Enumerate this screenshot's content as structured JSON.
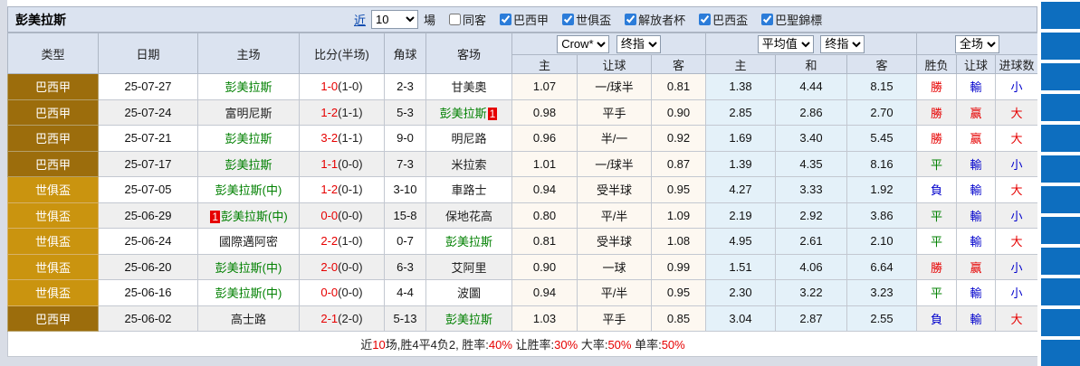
{
  "titlebar": {
    "team": "彭美拉斯",
    "near_link": "近",
    "games_value": "10",
    "games_suffix": "場",
    "checkboxes": [
      {
        "label": "同客",
        "checked": false
      },
      {
        "label": "巴西甲",
        "checked": true
      },
      {
        "label": "世俱盃",
        "checked": true
      },
      {
        "label": "解放者杯",
        "checked": true
      },
      {
        "label": "巴西盃",
        "checked": true
      },
      {
        "label": "巴聖錦標",
        "checked": true
      }
    ]
  },
  "header": {
    "type": "类型",
    "date": "日期",
    "home": "主场",
    "score": "比分(半场)",
    "corner": "角球",
    "away": "客场",
    "odds_source_select": "Crow*",
    "odds_kind_select": "终指",
    "avg_source_select": "平均值",
    "avg_kind_select": "终指",
    "scope_select": "全场",
    "sub": {
      "odds_home": "主",
      "odds_handicap": "让球",
      "odds_away": "客",
      "avg_home": "主",
      "avg_draw": "和",
      "avg_away": "客",
      "result": "胜负",
      "handicap_result": "让球",
      "goals": "进球数"
    }
  },
  "rows": [
    {
      "league": "巴西甲",
      "league_c": "dark",
      "date": "25-07-27",
      "home_badge_b": "",
      "home_name": "彭美拉斯",
      "home_c": "g",
      "home_badge_a": "",
      "score_ft": "1-0",
      "score_ht": "(1-0)",
      "corner": "2-3",
      "away_badge_b": "",
      "away_name": "甘美奧",
      "away_c": "k",
      "away_badge_a": "",
      "odds_home": "1.07",
      "odds_handicap": "一/球半",
      "odds_away": "0.81",
      "avg_home": "1.38",
      "avg_draw": "4.44",
      "avg_away": "8.15",
      "result": "勝",
      "result_c": "r",
      "handicap_result": "輸",
      "handicap_c": "b",
      "goals": "小",
      "goals_c": "b"
    },
    {
      "league": "巴西甲",
      "league_c": "dark",
      "date": "25-07-24",
      "home_badge_b": "",
      "home_name": "富明尼斯",
      "home_c": "k",
      "home_badge_a": "",
      "score_ft": "1-2",
      "score_ht": "(1-1)",
      "corner": "5-3",
      "away_badge_b": "",
      "away_name": "彭美拉斯",
      "away_c": "g",
      "away_badge_a": "1",
      "odds_home": "0.98",
      "odds_handicap": "平手",
      "odds_away": "0.90",
      "avg_home": "2.85",
      "avg_draw": "2.86",
      "avg_away": "2.70",
      "result": "勝",
      "result_c": "r",
      "handicap_result": "赢",
      "handicap_c": "r",
      "goals": "大",
      "goals_c": "r"
    },
    {
      "league": "巴西甲",
      "league_c": "dark",
      "date": "25-07-21",
      "home_badge_b": "",
      "home_name": "彭美拉斯",
      "home_c": "g",
      "home_badge_a": "",
      "score_ft": "3-2",
      "score_ht": "(1-1)",
      "corner": "9-0",
      "away_badge_b": "",
      "away_name": "明尼路",
      "away_c": "k",
      "away_badge_a": "",
      "odds_home": "0.96",
      "odds_handicap": "半/一",
      "odds_away": "0.92",
      "avg_home": "1.69",
      "avg_draw": "3.40",
      "avg_away": "5.45",
      "result": "勝",
      "result_c": "r",
      "handicap_result": "赢",
      "handicap_c": "r",
      "goals": "大",
      "goals_c": "r"
    },
    {
      "league": "巴西甲",
      "league_c": "dark",
      "date": "25-07-17",
      "home_badge_b": "",
      "home_name": "彭美拉斯",
      "home_c": "g",
      "home_badge_a": "",
      "score_ft": "1-1",
      "score_ht": "(0-0)",
      "corner": "7-3",
      "away_badge_b": "",
      "away_name": "米拉索",
      "away_c": "k",
      "away_badge_a": "",
      "odds_home": "1.01",
      "odds_handicap": "一/球半",
      "odds_away": "0.87",
      "avg_home": "1.39",
      "avg_draw": "4.35",
      "avg_away": "8.16",
      "result": "平",
      "result_c": "g",
      "handicap_result": "輸",
      "handicap_c": "b",
      "goals": "小",
      "goals_c": "b"
    },
    {
      "league": "世俱盃",
      "league_c": "gold",
      "date": "25-07-05",
      "home_badge_b": "",
      "home_name": "彭美拉斯(中)",
      "home_c": "g",
      "home_badge_a": "",
      "score_ft": "1-2",
      "score_ht": "(0-1)",
      "corner": "3-10",
      "away_badge_b": "",
      "away_name": "車路士",
      "away_c": "k",
      "away_badge_a": "",
      "odds_home": "0.94",
      "odds_handicap": "受半球",
      "odds_away": "0.95",
      "avg_home": "4.27",
      "avg_draw": "3.33",
      "avg_away": "1.92",
      "result": "負",
      "result_c": "b",
      "handicap_result": "輸",
      "handicap_c": "b",
      "goals": "大",
      "goals_c": "r"
    },
    {
      "league": "世俱盃",
      "league_c": "gold",
      "date": "25-06-29",
      "home_badge_b": "1",
      "home_name": "彭美拉斯(中)",
      "home_c": "g",
      "home_badge_a": "",
      "score_ft": "0-0",
      "score_ht": "(0-0)",
      "corner": "15-8",
      "away_badge_b": "",
      "away_name": "保地花高",
      "away_c": "k",
      "away_badge_a": "",
      "odds_home": "0.80",
      "odds_handicap": "平/半",
      "odds_away": "1.09",
      "avg_home": "2.19",
      "avg_draw": "2.92",
      "avg_away": "3.86",
      "result": "平",
      "result_c": "g",
      "handicap_result": "輸",
      "handicap_c": "b",
      "goals": "小",
      "goals_c": "b"
    },
    {
      "league": "世俱盃",
      "league_c": "gold",
      "date": "25-06-24",
      "home_badge_b": "",
      "home_name": "國際邁阿密",
      "home_c": "k",
      "home_badge_a": "",
      "score_ft": "2-2",
      "score_ht": "(1-0)",
      "corner": "0-7",
      "away_badge_b": "",
      "away_name": "彭美拉斯",
      "away_c": "g",
      "away_badge_a": "",
      "odds_home": "0.81",
      "odds_handicap": "受半球",
      "odds_away": "1.08",
      "avg_home": "4.95",
      "avg_draw": "2.61",
      "avg_away": "2.10",
      "result": "平",
      "result_c": "g",
      "handicap_result": "輸",
      "handicap_c": "b",
      "goals": "大",
      "goals_c": "r"
    },
    {
      "league": "世俱盃",
      "league_c": "gold",
      "date": "25-06-20",
      "home_badge_b": "",
      "home_name": "彭美拉斯(中)",
      "home_c": "g",
      "home_badge_a": "",
      "score_ft": "2-0",
      "score_ht": "(0-0)",
      "corner": "6-3",
      "away_badge_b": "",
      "away_name": "艾阿里",
      "away_c": "k",
      "away_badge_a": "",
      "odds_home": "0.90",
      "odds_handicap": "一球",
      "odds_away": "0.99",
      "avg_home": "1.51",
      "avg_draw": "4.06",
      "avg_away": "6.64",
      "result": "勝",
      "result_c": "r",
      "handicap_result": "赢",
      "handicap_c": "r",
      "goals": "小",
      "goals_c": "b"
    },
    {
      "league": "世俱盃",
      "league_c": "gold",
      "date": "25-06-16",
      "home_badge_b": "",
      "home_name": "彭美拉斯(中)",
      "home_c": "g",
      "home_badge_a": "",
      "score_ft": "0-0",
      "score_ht": "(0-0)",
      "corner": "4-4",
      "away_badge_b": "",
      "away_name": "波圖",
      "away_c": "k",
      "away_badge_a": "",
      "odds_home": "0.94",
      "odds_handicap": "平/半",
      "odds_away": "0.95",
      "avg_home": "2.30",
      "avg_draw": "3.22",
      "avg_away": "3.23",
      "result": "平",
      "result_c": "g",
      "handicap_result": "輸",
      "handicap_c": "b",
      "goals": "小",
      "goals_c": "b"
    },
    {
      "league": "巴西甲",
      "league_c": "dark",
      "date": "25-06-02",
      "home_badge_b": "",
      "home_name": "高士路",
      "home_c": "k",
      "home_badge_a": "",
      "score_ft": "2-1",
      "score_ht": "(2-0)",
      "corner": "5-13",
      "away_badge_b": "",
      "away_name": "彭美拉斯",
      "away_c": "g",
      "away_badge_a": "",
      "odds_home": "1.03",
      "odds_handicap": "平手",
      "odds_away": "0.85",
      "avg_home": "3.04",
      "avg_draw": "2.87",
      "avg_away": "2.55",
      "result": "負",
      "result_c": "b",
      "handicap_result": "輸",
      "handicap_c": "b",
      "goals": "大",
      "goals_c": "r"
    }
  ],
  "footer": {
    "segments": [
      "近",
      "10",
      "场,胜4平4负2, 胜率:",
      "40%",
      " 让胜率:",
      "30%",
      " 大率:",
      "50%",
      " 单率:",
      "50%"
    ]
  },
  "colors": {
    "league_dark": "#9c6d0c",
    "league_gold": "#ca940f",
    "win_red": "#e60000",
    "draw_green": "#008000",
    "loss_blue": "#0000cc",
    "team_green": "#008000",
    "odds_column_bg": "#fdf8f1",
    "avg_column_bg": "#e4f1f9",
    "header_bg": "#dbe3f0",
    "right_strip_blue": "#0d6ebf"
  }
}
